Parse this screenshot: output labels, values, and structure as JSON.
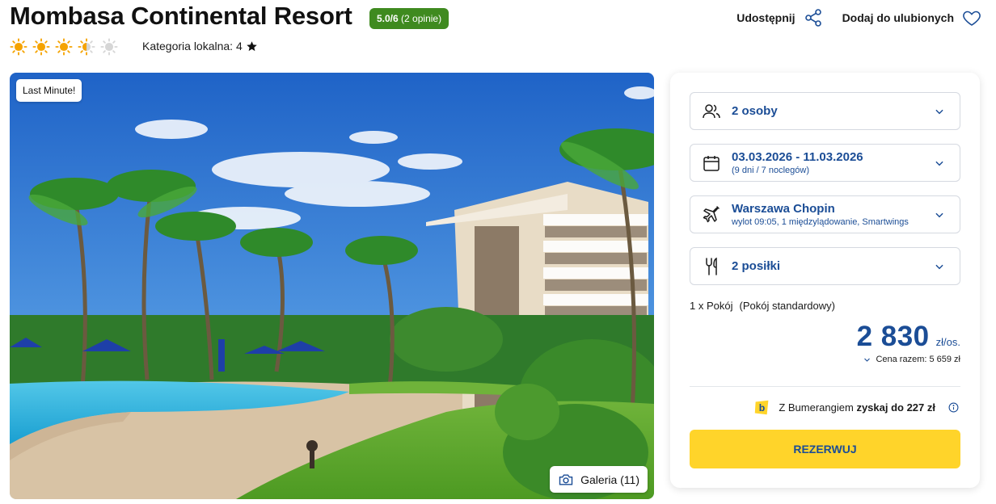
{
  "hotel": {
    "name": "Mombasa Continental Resort",
    "rating_score": "5.0/6",
    "rating_count": "(2 opinie)",
    "sun_rating": 3.5,
    "sun_max": 5,
    "category_label": "Kategoria lokalna: 4"
  },
  "actions": {
    "share_label": "Udostępnij",
    "favorite_label": "Dodaj do ulubionych"
  },
  "gallery": {
    "badge": "Last Minute!",
    "button_label": "Galeria (11)"
  },
  "booking": {
    "travelers": "2 osoby",
    "dates": "03.03.2026 - 11.03.2026",
    "dates_sub": "(9 dni / 7 noclegów)",
    "departure": "Warszawa Chopin",
    "departure_sub": "wylot 09:05, 1 międzylądowanie, Smartwings",
    "meals": "2 posiłki",
    "room_qty": "1 x Pokój",
    "room_type": "(Pokój standardowy)",
    "price": "2 830",
    "price_unit": "zł/os.",
    "total_label": "Cena razem: 5 659 zł",
    "bumerang_prefix": "Z Bumerangiem",
    "bumerang_bold": "zyskaj do 227 zł",
    "reserve_label": "REZERWUJ"
  },
  "colors": {
    "brand_blue": "#1b4d96",
    "cta_yellow": "#ffd42a",
    "rating_green": "#3f8a1f",
    "sun_orange": "#f5a300"
  },
  "icons": [
    "sun-icon",
    "star-icon",
    "share-icon",
    "heart-icon",
    "camera-icon",
    "users-icon",
    "calendar-icon",
    "plane-icon",
    "cutlery-icon",
    "chevron-down-icon",
    "bumerang-logo-icon",
    "info-icon"
  ]
}
